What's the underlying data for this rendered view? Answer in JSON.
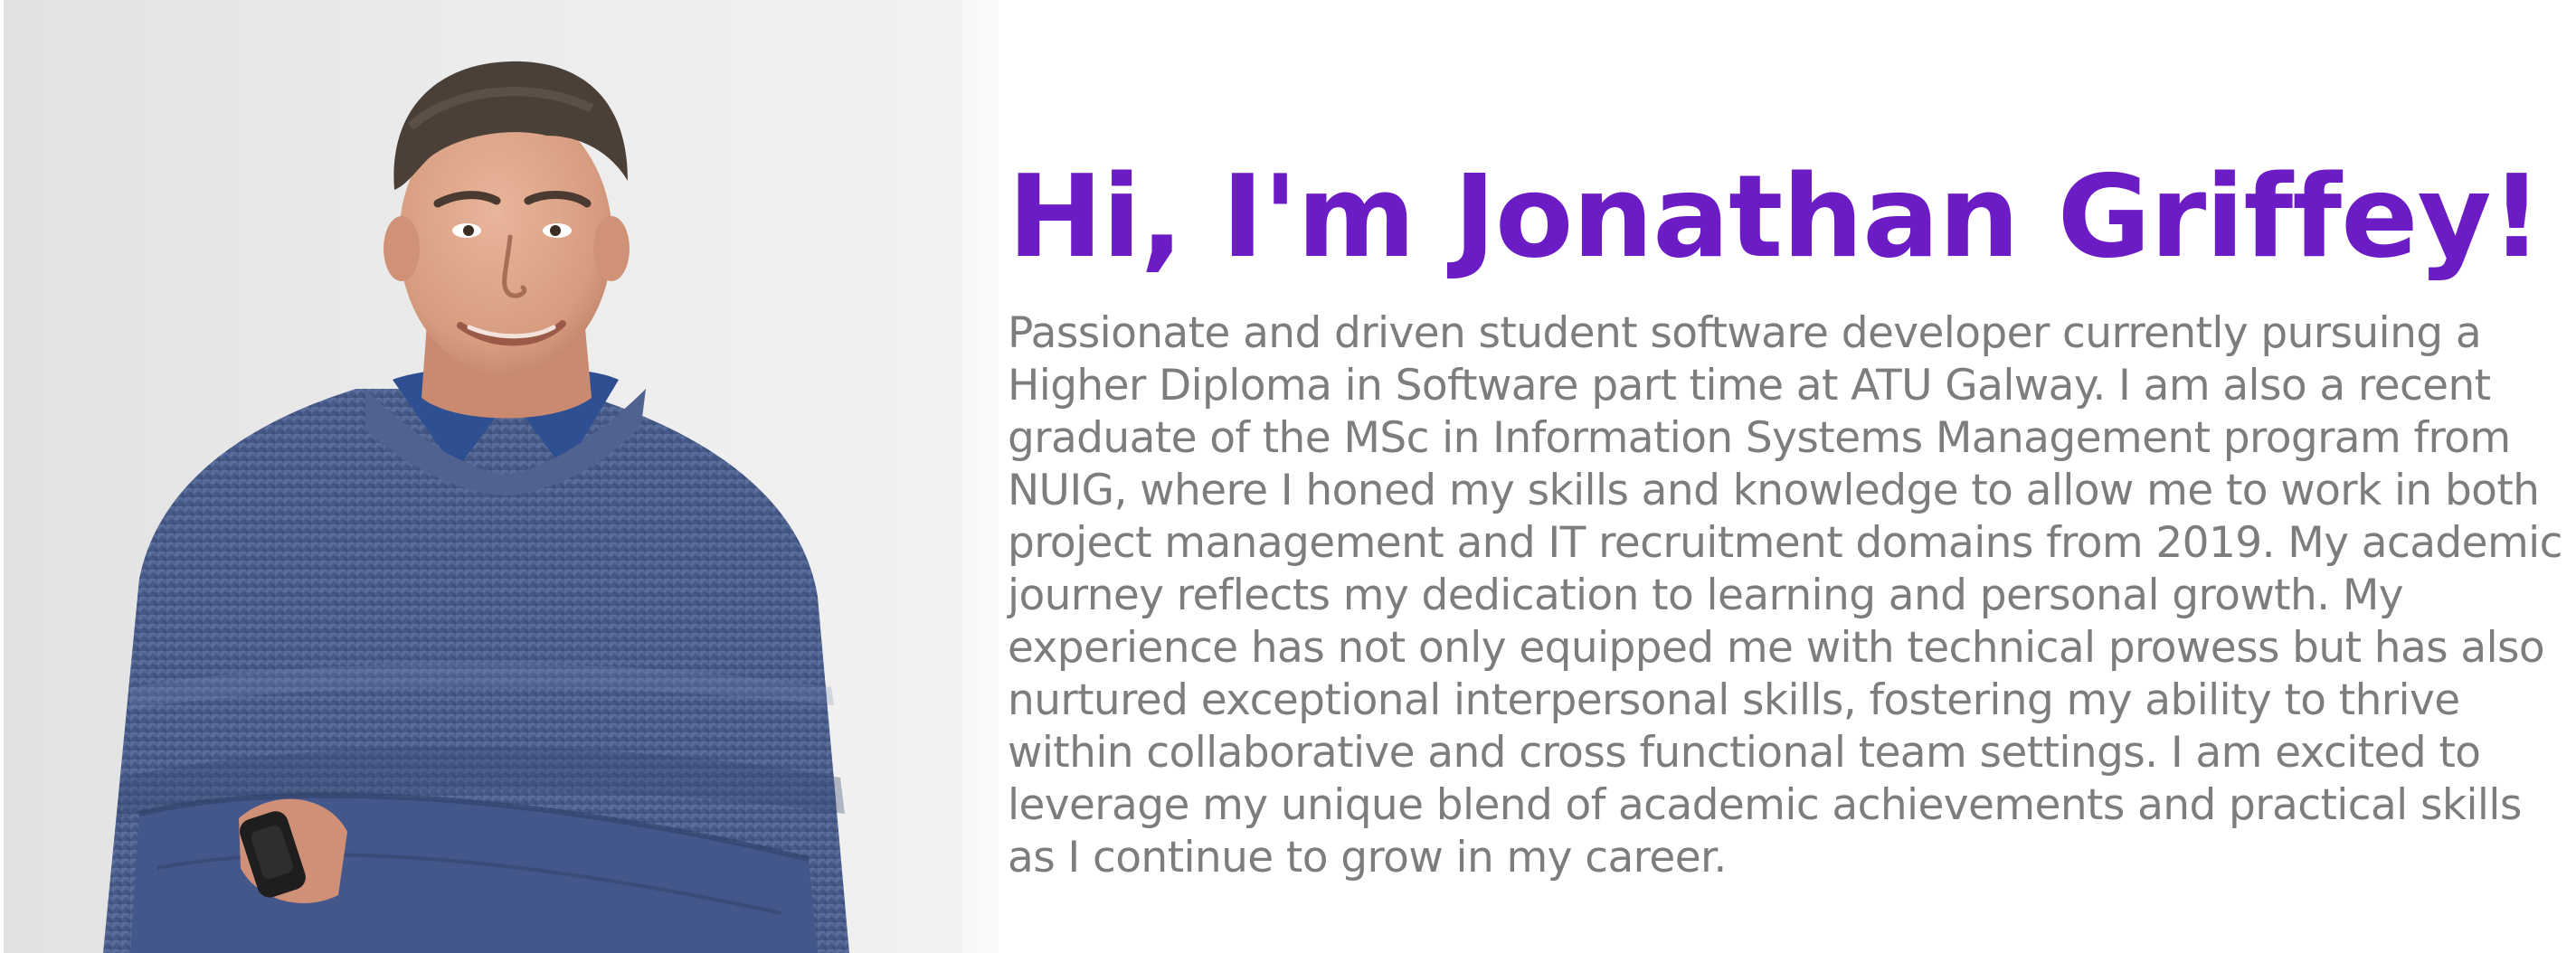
{
  "profile": {
    "headline": "Hi, I'm Jonathan Griffey!",
    "bio": "Passionate and driven student software developer currently pursuing a Higher Diploma in Software part time at ATU Galway. I am also a recent graduate of the MSc in Information Systems Management program from NUIG, where I honed my skills and knowledge to allow me to work in both project management and IT recruitment domains from 2019. My academic journey reflects my dedication to learning and personal growth. My experience has not only equipped me with technical prowess but has also nurtured exceptional interpersonal skills, fostering my ability to thrive within collaborative and cross functional team settings. I am excited to leverage my unique blend of academic achievements and practical skills as I continue to grow in my career."
  },
  "colors": {
    "headline": "#6c1cc4",
    "body_text": "#7d7d7d",
    "background": "#ffffff"
  },
  "icons": {
    "broken_image": "broken-image-icon"
  }
}
